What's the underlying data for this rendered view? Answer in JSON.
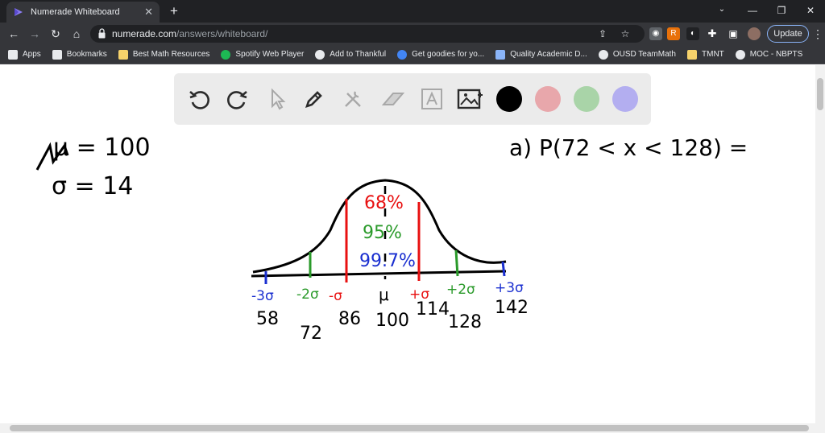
{
  "tab": {
    "title": "Numerade Whiteboard",
    "close": "✕"
  },
  "window": {
    "minimize": "—",
    "restore": "❐",
    "close": "✕",
    "toggle": "⌄"
  },
  "address": {
    "domain": "numerade.com",
    "path": "/answers/whiteboard/"
  },
  "toolbar": {
    "update_label": "Update"
  },
  "bookmarks": [
    {
      "label": "Apps",
      "icon": "apps-grid-icon",
      "color": "#e8eaed"
    },
    {
      "label": "Bookmarks",
      "icon": "star-icon",
      "color": "#e8eaed"
    },
    {
      "label": "Best Math Resources",
      "icon": "folder-icon",
      "color": "#f6d26b"
    },
    {
      "label": "Spotify Web Player",
      "icon": "spotify-icon",
      "color": "#1db954"
    },
    {
      "label": "Add to Thankful",
      "icon": "globe-icon",
      "color": "#e8eaed"
    },
    {
      "label": "Get goodies for yo...",
      "icon": "chrome-icon",
      "color": "#4285f4"
    },
    {
      "label": "Quality Academic D...",
      "icon": "doc-icon",
      "color": "#8ab4f8"
    },
    {
      "label": "OUSD TeamMath",
      "icon": "globe-icon",
      "color": "#e8eaed"
    },
    {
      "label": "TMNT",
      "icon": "folder-icon",
      "color": "#f6d26b"
    },
    {
      "label": "MOC - NBPTS",
      "icon": "wordpress-icon",
      "color": "#e8eaed"
    }
  ],
  "whiteboard": {
    "colors": {
      "black": "#000000",
      "red": "#e8a7ab",
      "green": "#a9d4a8",
      "purple": "#b3aef0"
    },
    "given_mu": "μ = 100",
    "given_sigma": "σ = 14",
    "question": "a)  P(72 < x < 128) =",
    "pct_68": "68%",
    "pct_95": "95%",
    "pct_997": "99.7%",
    "marks": [
      "-3σ",
      "-2σ",
      "-σ",
      "μ",
      "+σ",
      "+2σ",
      "+3σ"
    ],
    "values": [
      "58",
      "72",
      "86",
      "100",
      "114",
      "128",
      "142"
    ]
  }
}
